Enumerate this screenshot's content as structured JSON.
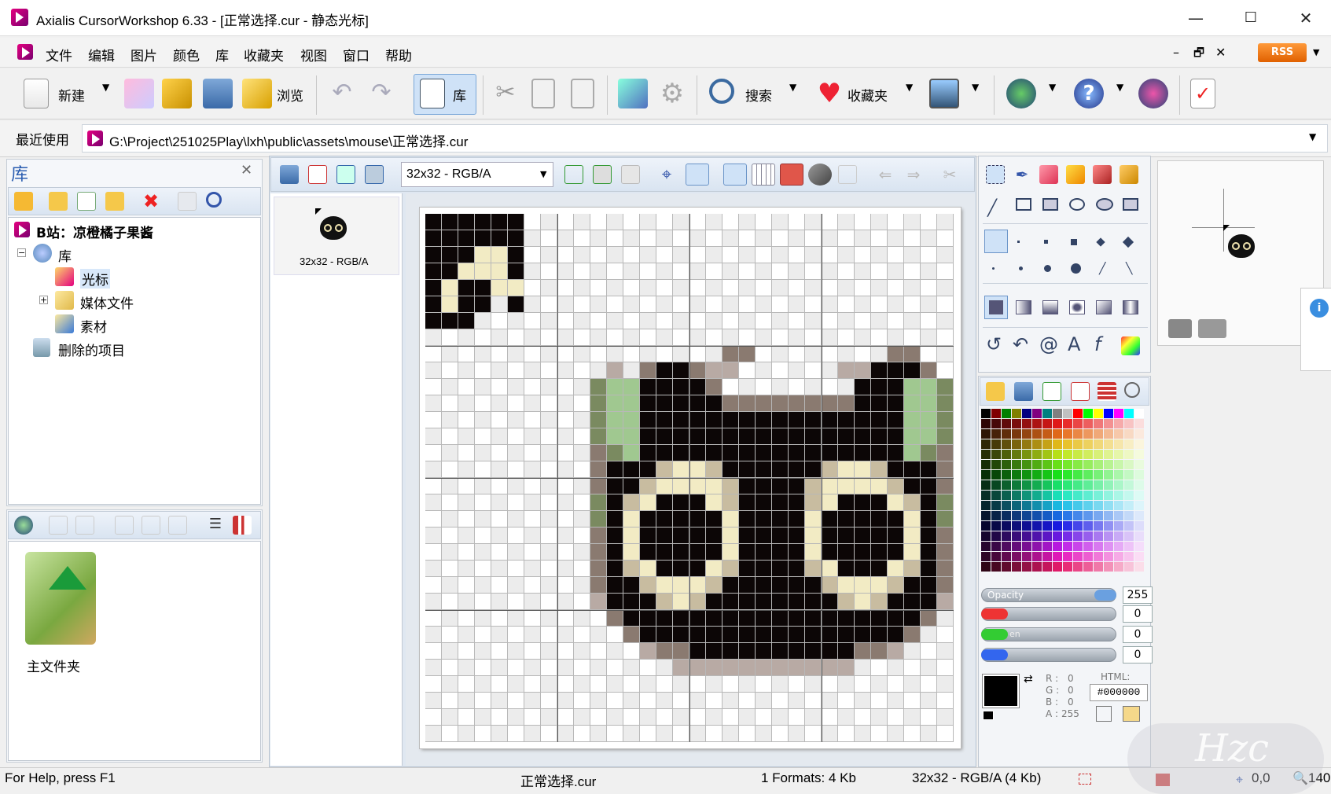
{
  "window": {
    "title": "Axialis CursorWorkshop 6.33 - [正常选择.cur - 静态光标]",
    "minimize": "—",
    "maximize": "☐",
    "close": "✕"
  },
  "menu": [
    "文件",
    "编辑",
    "图片",
    "颜色",
    "库",
    "收藏夹",
    "视图",
    "窗口",
    "帮助"
  ],
  "mdi": {
    "min": "–",
    "restore": "🗗",
    "close": "✕"
  },
  "rss": "RSS",
  "toolbar": {
    "new": "新建",
    "browse": "浏览",
    "library": "库",
    "search": "搜索",
    "favorites": "收藏夹"
  },
  "recent": {
    "label": "最近使用",
    "path": "G:\\Project\\251025Play\\lxh\\public\\assets\\mouse\\正常选择.cur"
  },
  "library": {
    "title": "库",
    "close": "✕",
    "tree": [
      {
        "label": "B站：凉橙橘子果酱",
        "bold": true
      },
      {
        "label": "库"
      },
      {
        "label": "光标"
      },
      {
        "label": "媒体文件"
      },
      {
        "label": "素材"
      },
      {
        "label": "删除的项目"
      }
    ],
    "folder": "主文件夹"
  },
  "formats": {
    "selected": "32x32 - RGB/A",
    "thumb_label": "32x32 - RGB/A"
  },
  "palette": {
    "opacity_label": "Opacity",
    "opacity": "255",
    "red": "0",
    "green": "0",
    "blue": "0",
    "green_label": "en",
    "r_label": "R :",
    "g_label": "G :",
    "b_label": "B :",
    "a_label": "A :",
    "r": "0",
    "g": "0",
    "b": "0",
    "a": "255",
    "html_label": "HTML:",
    "html": "#000000"
  },
  "status": {
    "help": "For Help, press F1",
    "file": "正常选择.cur",
    "formats": "1 Formats: 4 Kb",
    "size": "32x32 - RGB/A (4 Kb)",
    "coords": "0,0",
    "zoom": "140"
  },
  "watermark": "Hzc"
}
